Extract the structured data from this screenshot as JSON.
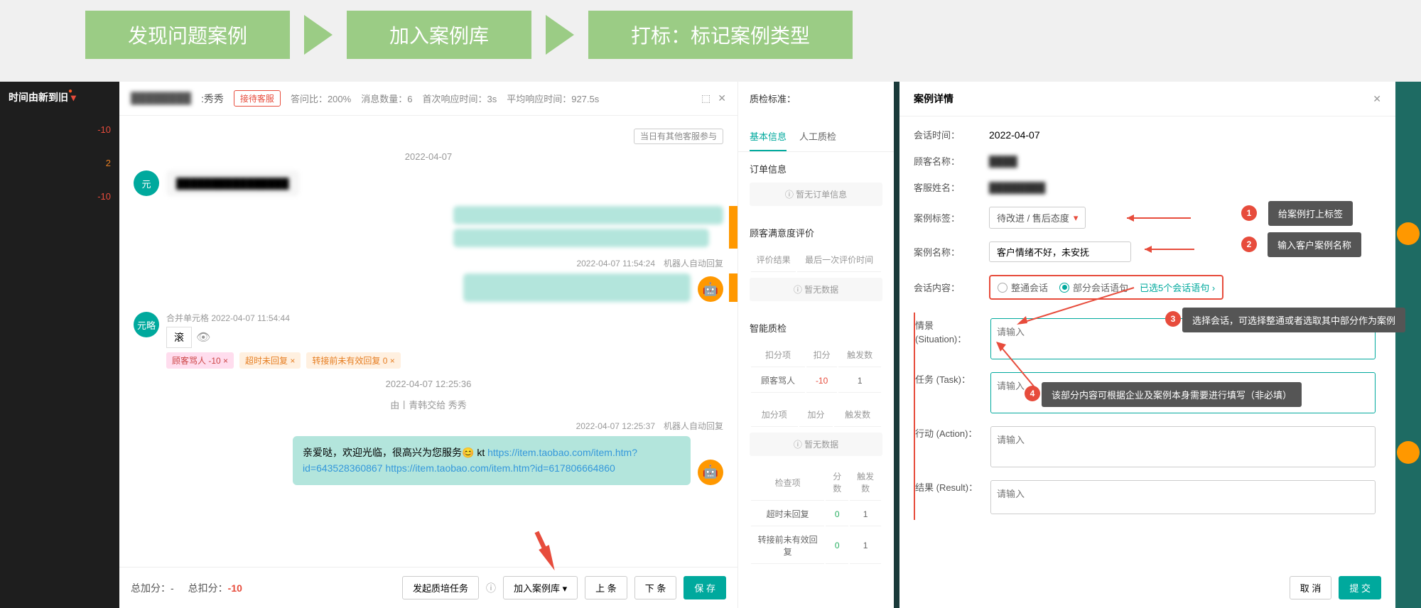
{
  "workflow": {
    "step1": "发现问题案例",
    "step2": "加入案例库",
    "step3": "打标：标记案例类型"
  },
  "sidebar": {
    "sort_label": "时间由新到旧",
    "items": [
      {
        "badge": "-10"
      },
      {
        "badge": "2"
      },
      {
        "badge": "-10"
      }
    ]
  },
  "chat": {
    "name_suffix": ":秀秀",
    "wait_tag": "接待客服",
    "stats": {
      "resp_rate_label": "答问比：",
      "resp_rate": "200%",
      "msg_count_label": "消息数量：",
      "msg_count": "6",
      "first_resp_label": "首次响应时间：",
      "first_resp": "3s",
      "avg_resp_label": "平均响应时间：",
      "avg_resp": "927.5s"
    },
    "tag_other": "当日有其他客服参与",
    "date": "2022-04-07",
    "msg_time1": "2022-04-07 11:54:24　机器人自动回复",
    "merge_label": "合并单元格",
    "merge_time": "2022-04-07 11:54:44",
    "roll_text": "滚",
    "tags": {
      "t1": "顾客骂人 -10 ×",
      "t2": "超时未回复 ×",
      "t3": "转接前未有效回复 0 ×"
    },
    "time2": "2022-04-07 12:25:36",
    "by_line": "由丨青韩交给 秀秀",
    "time3": "2022-04-07 12:25:37　机器人自动回复",
    "welcome": "亲爱哒，欢迎光临，很高兴为您服务😊 kt ",
    "link1": "https://item.taobao.com/item.htm?id=643528360867",
    "link2": "https://item.taobao.com/item.htm?id=617806664860",
    "footer": {
      "add_label": "总加分：",
      "add_val": "-",
      "sub_label": "总扣分：",
      "sub_val": "-10",
      "btn_task": "发起质培任务",
      "btn_add_case": "加入案例库",
      "btn_prev": "上 条",
      "btn_next": "下 条",
      "btn_save": "保 存"
    }
  },
  "qc": {
    "standard_label": "质检标准：",
    "tab_basic": "基本信息",
    "tab_manual": "人工质检",
    "order_title": "订单信息",
    "no_order": "暂无订单信息",
    "satisfy_title": "顾客满意度评价",
    "col_result": "评价结果",
    "col_last_time": "最后一次评价时间",
    "no_data": "暂无数据",
    "intel_title": "智能质检",
    "deduct": {
      "col1": "扣分项",
      "col2": "扣分",
      "col3": "触发数",
      "row1_label": "顾客骂人",
      "row1_score": "-10",
      "row1_count": "1"
    },
    "add": {
      "col1": "加分项",
      "col2": "加分",
      "col3": "触发数"
    },
    "check": {
      "col1": "检查项",
      "col2": "分数",
      "col3": "触发数",
      "row1_label": "超时未回复",
      "row1_score": "0",
      "row1_count": "1",
      "row2_label": "转接前未有效回复",
      "row2_score": "0",
      "row2_count": "1"
    }
  },
  "detail": {
    "title": "案例详情",
    "time_label": "会话时间：",
    "time_value": "2022-04-07",
    "customer_label": "顾客名称：",
    "agent_label": "客服姓名：",
    "tag_label": "案例标签：",
    "tag_value": "待改进 / 售后态度",
    "name_label": "案例名称：",
    "name_value": "客户情绪不好，未安抚",
    "content_label": "会话内容：",
    "radio_full": "整通会话",
    "radio_partial": "部分会话语句",
    "selected_hint": "已选5个会话语句 ›",
    "situation_label": "情景 (Situation)：",
    "task_label": "任务 (Task)：",
    "action_label": "行动 (Action)：",
    "result_label": "结果 (Result)：",
    "placeholder": "请输入",
    "callout1": "给案例打上标签",
    "callout2": "输入客户案例名称",
    "callout3": "选择会话，可选择整通或者选取其中部分作为案例",
    "callout4": "该部分内容可根据企业及案例本身需要进行填写（非必填）",
    "btn_cancel": "取 消",
    "btn_submit": "提 交"
  }
}
